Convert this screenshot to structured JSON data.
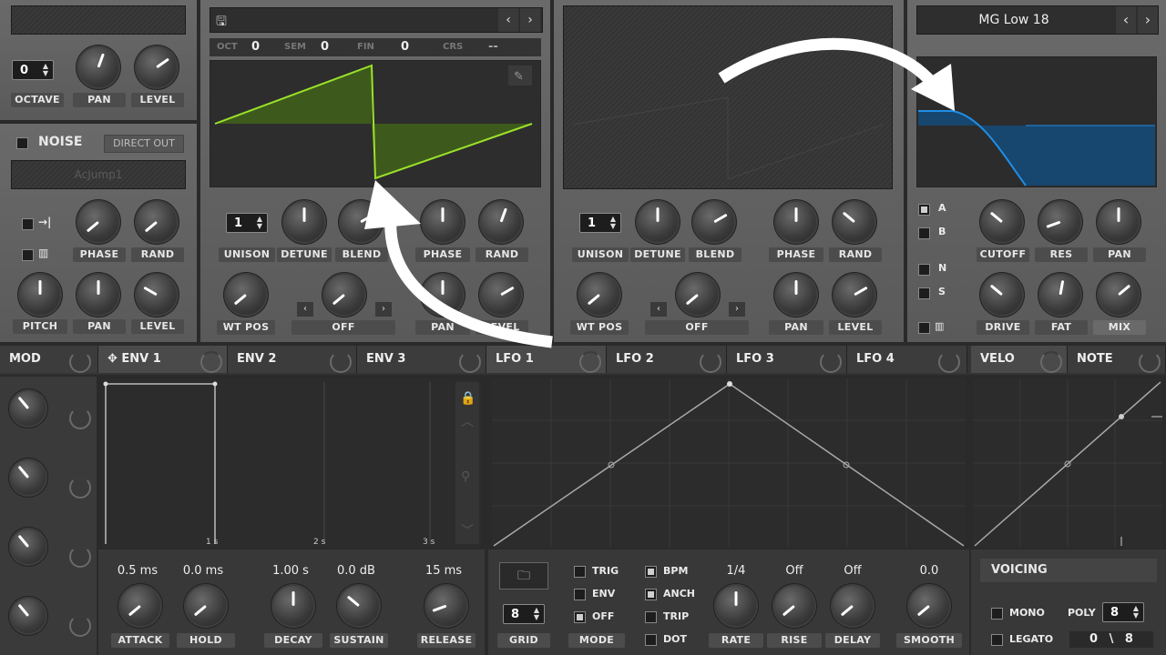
{
  "osc_left": {
    "octave_value": "0",
    "octave_label": "OCTAVE",
    "pan_label": "PAN",
    "level_label": "LEVEL"
  },
  "noise": {
    "label": "NOISE",
    "direct_out": "DIRECT OUT",
    "preset": "AcJump1",
    "phase_label": "PHASE",
    "rand_label": "RAND",
    "pitch_label": "PITCH",
    "pan_label": "PAN",
    "level_label": "LEVEL"
  },
  "osc_a": {
    "oct_label": "OCT",
    "oct_value": "0",
    "sem_label": "SEM",
    "sem_value": "0",
    "fin_label": "FIN",
    "fin_value": "0",
    "crs_label": "CRS",
    "crs_value": "--",
    "unison_value": "1",
    "unison_label": "UNISON",
    "detune_label": "DETUNE",
    "blend_label": "BLEND",
    "phase_label": "PHASE",
    "rand_label": "RAND",
    "wtpos_label": "WT POS",
    "off_label": "OFF",
    "pan_label": "PAN",
    "level_label": "LEVEL"
  },
  "osc_b": {
    "unison_value": "1",
    "unison_label": "UNISON",
    "detune_label": "DETUNE",
    "blend_label": "BLEND",
    "phase_label": "PHASE",
    "rand_label": "RAND",
    "wtpos_label": "WT POS",
    "off_label": "OFF",
    "pan_label": "PAN",
    "level_label": "LEVEL"
  },
  "filter": {
    "preset": "MG Low 18",
    "a": "A",
    "b": "B",
    "n": "N",
    "s": "S",
    "cutoff_label": "CUTOFF",
    "res_label": "RES",
    "pan_label": "PAN",
    "drive_label": "DRIVE",
    "fat_label": "FAT",
    "mix_label": "MIX"
  },
  "tabs": {
    "mod": "MOD",
    "env1": "ENV 1",
    "env2": "ENV 2",
    "env3": "ENV 3",
    "lfo1": "LFO 1",
    "lfo2": "LFO 2",
    "lfo3": "LFO 3",
    "lfo4": "LFO 4",
    "velo": "VELO",
    "note": "NOTE"
  },
  "env": {
    "t1": "1 s",
    "t2": "2 s",
    "t3": "3 s",
    "attack_value": "0.5 ms",
    "hold_value": "0.0 ms",
    "decay_value": "1.00 s",
    "sustain_value": "0.0 dB",
    "release_value": "15 ms",
    "attack_label": "ATTACK",
    "hold_label": "HOLD",
    "decay_label": "DECAY",
    "sustain_label": "SUSTAIN",
    "release_label": "RELEASE"
  },
  "lfo": {
    "grid_value": "8",
    "grid_label": "GRID",
    "trig": "TRIG",
    "env": "ENV",
    "off": "OFF",
    "mode_label": "MODE",
    "bpm": "BPM",
    "anch": "ANCH",
    "trip": "TRIP",
    "dot": "DOT",
    "rate_value": "1/4",
    "rise_value": "Off",
    "delay_value": "Off",
    "smooth_value": "0.0",
    "rate_label": "RATE",
    "rise_label": "RISE",
    "delay_label": "DELAY",
    "smooth_label": "SMOOTH"
  },
  "voicing": {
    "title": "VOICING",
    "mono": "MONO",
    "legato": "LEGATO",
    "poly_label": "POLY",
    "poly_value": "8",
    "count_a": "0",
    "count_sep": "\\",
    "count_b": "8"
  },
  "colors": {
    "wave_green": "#9be22a",
    "filter_blue": "#1f8ee6"
  }
}
